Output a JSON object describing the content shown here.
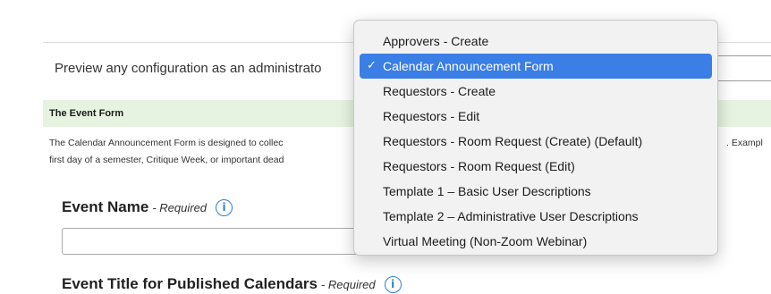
{
  "preview": {
    "label": "Preview any configuration as an administrato"
  },
  "section": {
    "title": "The Event Form",
    "desc_line1": "The Calendar Announcement Form is designed to collec",
    "desc_line2": "first day of a semester, Critique Week, or important dead",
    "desc_tail": ". Exampl"
  },
  "fields": [
    {
      "label": "Event Name",
      "required": "- Required",
      "info_icon": "i"
    },
    {
      "label": "Event Title for Published Calendars",
      "required": "- Required",
      "info_icon": "i"
    }
  ],
  "dropdown": {
    "checkmark": "✓",
    "selected_index": 1,
    "options": [
      "Approvers - Create",
      "Calendar Announcement Form",
      "Requestors - Create",
      "Requestors - Edit",
      "Requestors - Room Request (Create) (Default)",
      "Requestors - Room Request (Edit)",
      "Template 1 – Basic User Descriptions",
      "Template 2 – Administrative User Descriptions",
      "Virtual Meeting (Non-Zoom Webinar)"
    ]
  },
  "colors": {
    "accent": "#3a7ee6",
    "section_bg": "#e6f3e0",
    "info_icon": "#2f7fd6"
  }
}
